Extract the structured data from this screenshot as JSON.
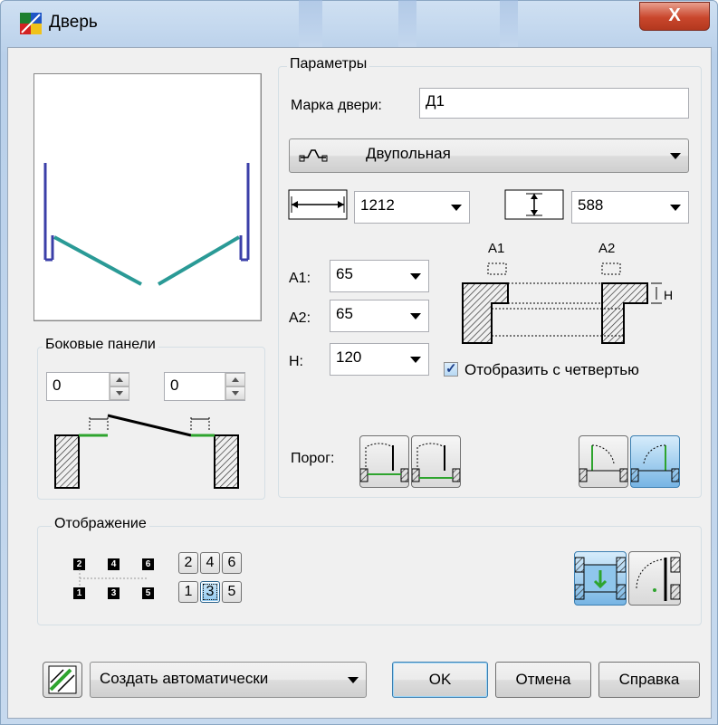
{
  "window": {
    "title": "Дверь",
    "close_label": "X"
  },
  "params": {
    "group_label": "Параметры",
    "mark_label": "Марка двери:",
    "mark_value": "Д1",
    "type_value": "Двупольная",
    "width_value": "1212",
    "depth_value": "588",
    "a1_label": "A1:",
    "a1_value": "65",
    "a2_label": "A2:",
    "a2_value": "65",
    "h_label": "H:",
    "h_value": "120",
    "quarter_label": "Отобразить с четвертью",
    "quarter_checked": true,
    "threshold_label": "Порог:",
    "diagram_a1": "A1",
    "diagram_a2": "A2",
    "diagram_h": "H"
  },
  "side_panels": {
    "group_label": "Боковые панели",
    "left_value": "0",
    "right_value": "0"
  },
  "display": {
    "group_label": "Отображение",
    "top_markers": [
      "2",
      "4",
      "6"
    ],
    "bottom_markers": [
      "1",
      "3",
      "5"
    ],
    "top_buttons": [
      "2",
      "4",
      "6"
    ],
    "bottom_buttons": [
      "1",
      "3",
      "5"
    ],
    "active_button": "3"
  },
  "footer": {
    "create_mode": "Создать автоматически",
    "ok": "OK",
    "cancel": "Отмена",
    "help": "Справка"
  },
  "colors": {
    "door_leaf": "#2a9a96",
    "frame_line": "#3b3fa8",
    "threshold_green": "#2ea42e"
  }
}
